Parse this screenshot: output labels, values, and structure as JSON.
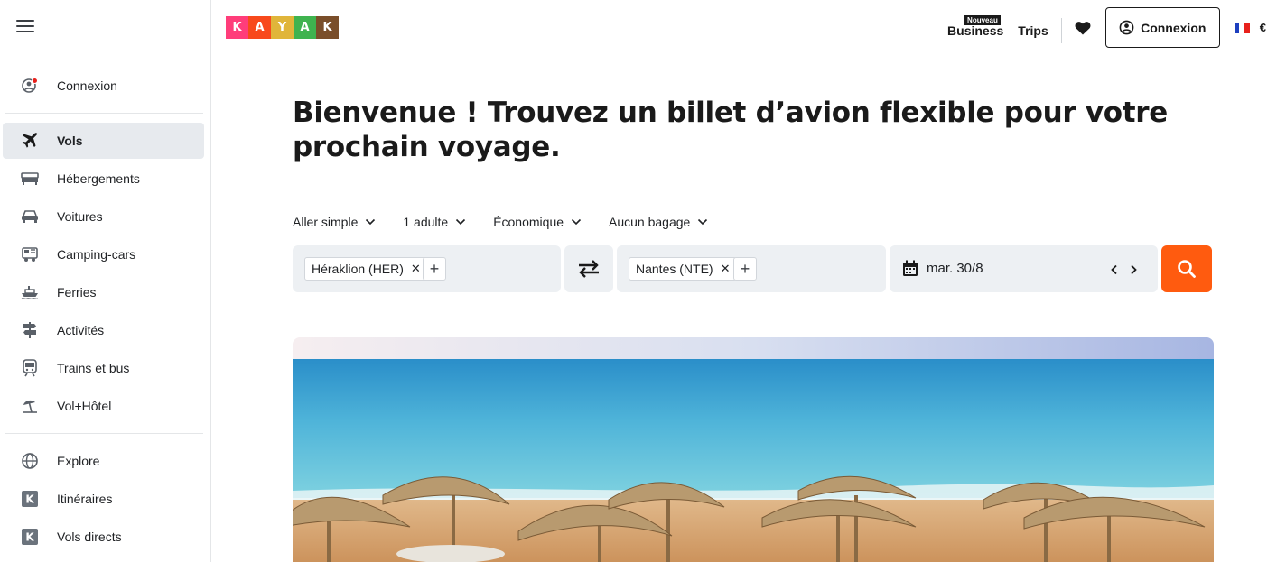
{
  "sidebar": {
    "login_label": "Connexion",
    "items": [
      {
        "label": "Vols",
        "icon": "plane-icon",
        "active": true
      },
      {
        "label": "Hébergements",
        "icon": "bed-icon"
      },
      {
        "label": "Voitures",
        "icon": "car-icon"
      },
      {
        "label": "Camping-cars",
        "icon": "camper-icon"
      },
      {
        "label": "Ferries",
        "icon": "ferry-icon"
      },
      {
        "label": "Activités",
        "icon": "signpost-icon"
      },
      {
        "label": "Trains et bus",
        "icon": "train-icon"
      },
      {
        "label": "Vol+Hôtel",
        "icon": "beach-umbrella-icon"
      }
    ],
    "extra": [
      {
        "label": "Explore",
        "icon": "globe-icon"
      },
      {
        "label": "Itinéraires",
        "icon": "kayak-k-icon"
      },
      {
        "label": "Vols directs",
        "icon": "kayak-k-icon"
      }
    ]
  },
  "header": {
    "logo_letters": [
      "K",
      "A",
      "Y",
      "A",
      "K"
    ],
    "business_badge": "Nouveau",
    "business_label": "Business",
    "trips_label": "Trips",
    "login_button": "Connexion",
    "currency": "€"
  },
  "main": {
    "headline": "Bienvenue ! Trouvez un billet d’avion flexible pour votre prochain voyage.",
    "options": {
      "trip_type": "Aller simple",
      "travelers": "1 adulte",
      "cabin": "Économique",
      "bags": "Aucun bagage"
    },
    "origin": "Héraklion (HER)",
    "destination": "Nantes (NTE)",
    "date": "mar. 30/8"
  },
  "colors": {
    "accent": "#ff5b0f",
    "field_bg": "#edf0f3",
    "active_bg": "#e7eaee"
  }
}
